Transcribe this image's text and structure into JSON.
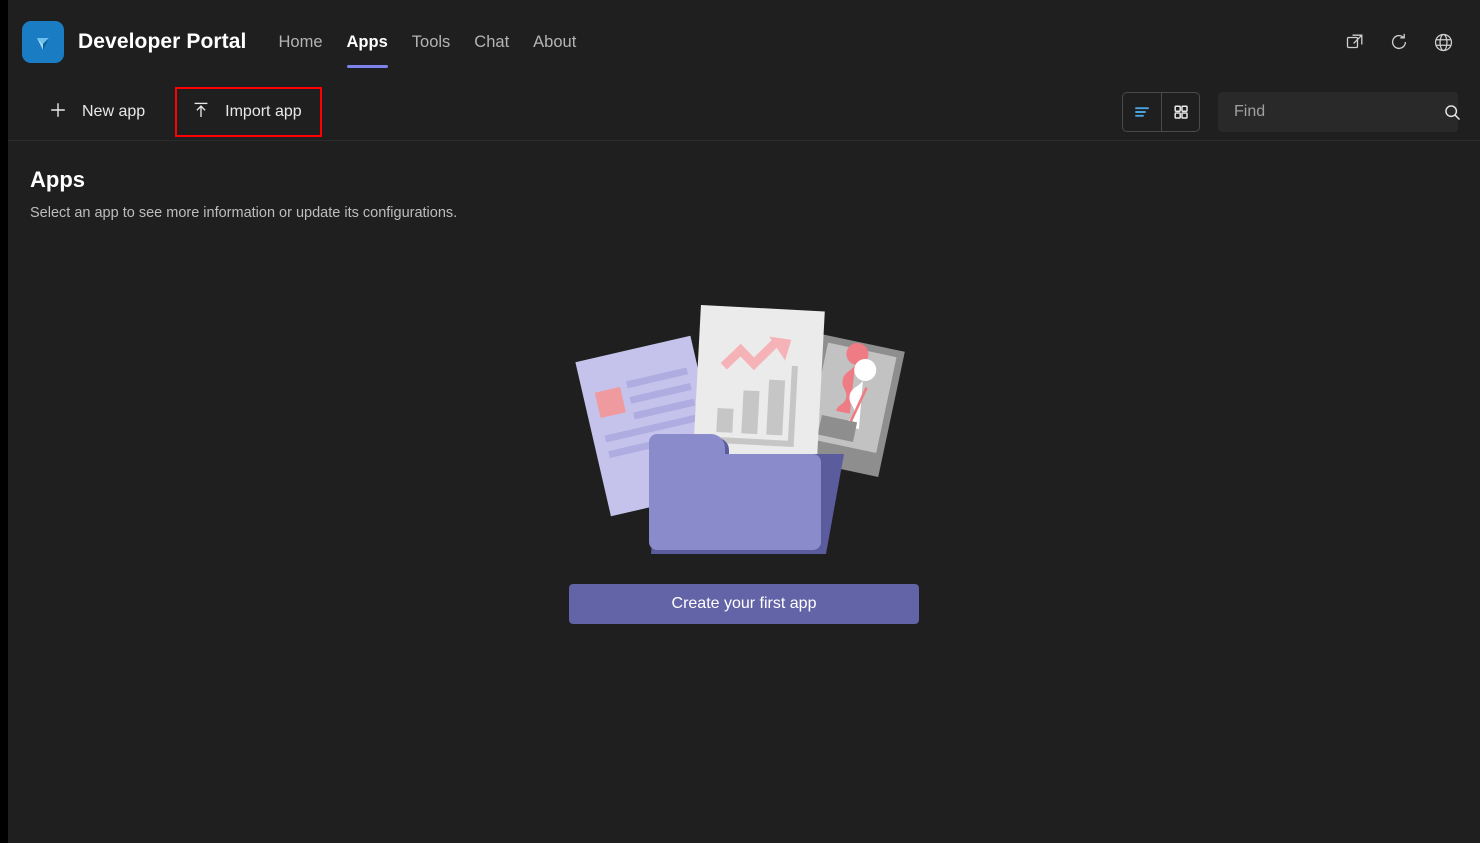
{
  "window": {
    "background": "#1f1f1f",
    "outer_border": "#000000"
  },
  "header": {
    "logo_icon": "teams-developer-portal-logo-icon",
    "logo_color": "#1a7dc4",
    "title": "Developer Portal",
    "nav": [
      {
        "label": "Home",
        "active": false
      },
      {
        "label": "Apps",
        "active": true
      },
      {
        "label": "Tools",
        "active": false
      },
      {
        "label": "Chat",
        "active": false
      },
      {
        "label": "About",
        "active": false
      }
    ],
    "active_tab_underline_color": "#7b83eb",
    "actions": [
      {
        "icon": "open-in-new-window-icon"
      },
      {
        "icon": "refresh-icon"
      },
      {
        "icon": "globe-icon"
      }
    ]
  },
  "toolbar": {
    "new_app": {
      "label": "New app",
      "icon": "plus-icon"
    },
    "import_app": {
      "label": "Import app",
      "icon": "upload-arrow-icon",
      "highlighted": true,
      "highlight_color": "#ff0000"
    },
    "view_list": {
      "icon": "list-view-icon",
      "active": true,
      "active_color": "#4aa3e0"
    },
    "view_grid": {
      "icon": "grid-view-icon",
      "active": false
    },
    "search": {
      "placeholder": "Find",
      "value": "",
      "icon": "search-icon"
    }
  },
  "main": {
    "title": "Apps",
    "subtitle": "Select an app to see more information or update its configurations.",
    "empty_state": {
      "illustration": "folder-with-documents-illustration",
      "cta_label": "Create your first app",
      "cta_color": "#6264a7"
    }
  },
  "colors": {
    "accent_purple": "#7b83eb",
    "button_purple": "#6264a7",
    "doc_lavender": "#c5c3ec",
    "folder_front": "#8a8bcb",
    "folder_back": "#5b5c9e",
    "paper_white": "#ebebeb",
    "photo_gray": "#a9a9a9",
    "accent_pink": "#ef9a9e",
    "highlight_red": "#ff0000"
  }
}
